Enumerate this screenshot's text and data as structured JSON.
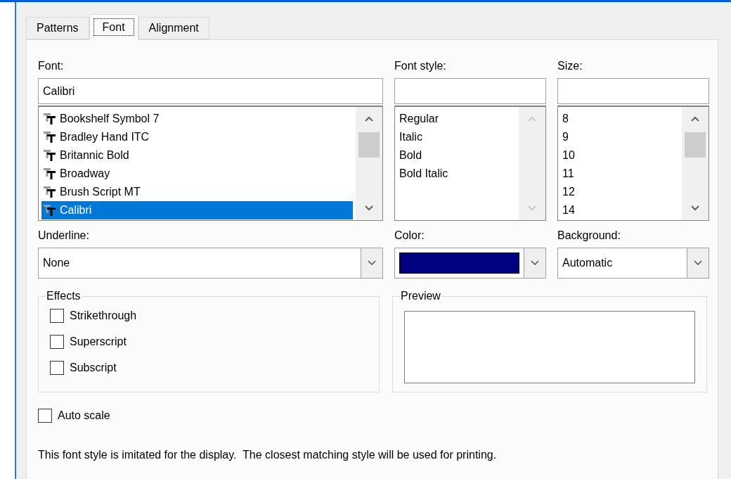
{
  "tabs": [
    {
      "label": "Patterns",
      "selected": false
    },
    {
      "label": "Font",
      "selected": true
    },
    {
      "label": "Alignment",
      "selected": false
    }
  ],
  "font": {
    "label": "Font:",
    "value": "Calibri",
    "scroll_disabled": false,
    "items": [
      {
        "label": "Bookshelf Symbol 7",
        "selected": false
      },
      {
        "label": "Bradley Hand ITC",
        "selected": false
      },
      {
        "label": "Britannic Bold",
        "selected": false
      },
      {
        "label": "Broadway",
        "selected": false
      },
      {
        "label": "Brush Script MT",
        "selected": false
      },
      {
        "label": "Calibri",
        "selected": true
      }
    ]
  },
  "font_style": {
    "label": "Font style:",
    "scroll_disabled": true,
    "items": [
      {
        "label": "Regular",
        "selected": false
      },
      {
        "label": "Italic",
        "selected": false
      },
      {
        "label": "Bold",
        "selected": false
      },
      {
        "label": "Bold Italic",
        "selected": false
      }
    ]
  },
  "size": {
    "label": "Size:",
    "scroll_disabled": false,
    "items": [
      {
        "label": "8",
        "selected": false
      },
      {
        "label": "9",
        "selected": false
      },
      {
        "label": "10",
        "selected": false
      },
      {
        "label": "11",
        "selected": false
      },
      {
        "label": "12",
        "selected": false
      },
      {
        "label": "14",
        "selected": false
      }
    ]
  },
  "underline": {
    "label": "Underline:",
    "value": "None"
  },
  "color": {
    "label": "Color:",
    "color": "#000080"
  },
  "background": {
    "label": "Background:",
    "value": "Automatic"
  },
  "effects": {
    "title": "Effects",
    "items": [
      {
        "label": "Strikethrough",
        "checked": false
      },
      {
        "label": "Superscript",
        "checked": false
      },
      {
        "label": "Subscript",
        "checked": false
      }
    ]
  },
  "preview": {
    "title": "Preview"
  },
  "auto_scale": {
    "label": "Auto scale",
    "checked": false
  },
  "note": "This font style is imitated for the display.  The closest matching style will be used for printing."
}
